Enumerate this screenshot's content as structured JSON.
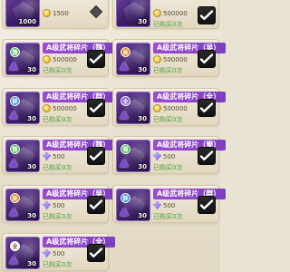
{
  "cards": [
    {
      "name": "",
      "price": "1500",
      "currency": "coin",
      "qty": "1000",
      "bought": "",
      "badge": "",
      "badge_color": "",
      "checked": false
    },
    {
      "name": "",
      "price": "500000",
      "currency": "coin",
      "qty": "30",
      "bought": "已购买0次",
      "badge": "",
      "badge_color": "",
      "checked": true
    },
    {
      "name": "A级武将碎片（魏）",
      "price": "500000",
      "currency": "coin",
      "qty": "30",
      "bought": "已购买0次",
      "badge": "魏",
      "badge_color": "green",
      "checked": true
    },
    {
      "name": "A级武将碎片（吴）",
      "price": "500000",
      "currency": "coin",
      "qty": "30",
      "bought": "已购买0次",
      "badge": "吴",
      "badge_color": "orange",
      "checked": true
    },
    {
      "name": "A级武将碎片（群）",
      "price": "500000",
      "currency": "coin",
      "qty": "30",
      "bought": "已购买0次",
      "badge": "群",
      "badge_color": "blue",
      "checked": true
    },
    {
      "name": "A级武将碎片（全）",
      "price": "500000",
      "currency": "coin",
      "qty": "30",
      "bought": "已购买0次",
      "badge": "全",
      "badge_color": "purple",
      "checked": true
    },
    {
      "name": "A级武将碎片（魏）",
      "price": "500",
      "currency": "gem",
      "qty": "30",
      "bought": "已购买0次",
      "badge": "魏",
      "badge_color": "green",
      "checked": true
    },
    {
      "name": "A级武将碎片（蜀）",
      "price": "500",
      "currency": "gem",
      "qty": "30",
      "bought": "已购买0次",
      "badge": "蜀",
      "badge_color": "green",
      "checked": true
    },
    {
      "name": "A级武将碎片（吴）",
      "price": "500",
      "currency": "gem",
      "qty": "30",
      "bought": "已购买0次",
      "badge": "吴",
      "badge_color": "orange",
      "checked": true
    },
    {
      "name": "A级武将碎片（群）",
      "price": "500",
      "currency": "gem",
      "qty": "30",
      "bought": "已购买0次",
      "badge": "群",
      "badge_color": "blue",
      "checked": true
    },
    {
      "name": "A级武将碎片（全）",
      "price": "500",
      "currency": "gem",
      "qty": "30",
      "bought": "已购买0次",
      "badge": "全",
      "badge_color": "white",
      "checked": true
    }
  ]
}
